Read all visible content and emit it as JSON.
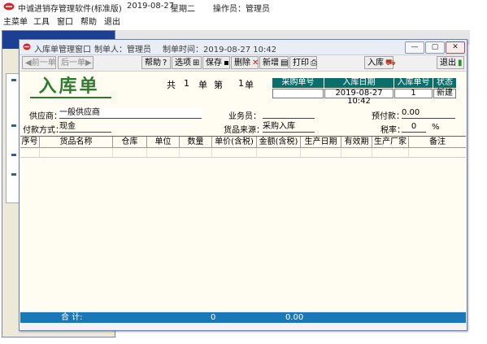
{
  "app": {
    "title": "中诚进销存管理软件(标准版)",
    "date": "2019-08-27",
    "weekday": "星期二",
    "operator_label": "操作员：管理员"
  },
  "menu": [
    "主菜单",
    "工具",
    "窗口",
    "帮助",
    "退出"
  ],
  "window": {
    "title": "入库单管理窗口",
    "maker_label": "制单人：管理员",
    "time_label": "制单时间：2019-08-27 10:42",
    "btn_min": "—",
    "btn_max": "▢",
    "btn_close": "✕"
  },
  "toolbar": {
    "prev": "◀前一单",
    "next": "后一单▶",
    "help": "帮助",
    "options": "选项",
    "save": "保存",
    "delete": "删除",
    "add": "新增",
    "print": "打印",
    "stock_in": "入库",
    "exit": "退出"
  },
  "form": {
    "title": "入库单",
    "count_total_label": "共",
    "count_total": "1",
    "count_unit1": "单",
    "count_index_label": "第",
    "count_index": "1",
    "count_unit2": "单",
    "info_headers": [
      "采购单号",
      "入库日期",
      "入库单号",
      "状态"
    ],
    "info_values": [
      "",
      "2019-08-27 10:42",
      "1",
      "新建"
    ],
    "supplier_label": "供应商：",
    "supplier": "一般供应商",
    "salesman_label": "业务员：",
    "salesman": "",
    "prepay_label": "预付款：",
    "prepay": "0.00",
    "payment_label": "付款方式：",
    "payment": "现金",
    "source_label": "货品来源：",
    "source": "采购入库",
    "tax_label": "税率：",
    "tax": "0",
    "tax_unit": "%"
  },
  "grid": {
    "columns": [
      "序号",
      "货品名称",
      "仓库",
      "单位",
      "数量",
      "单价(含税)",
      "金额(含税)",
      "生产日期",
      "有效期",
      "生产厂家",
      "备注"
    ],
    "rows": []
  },
  "totals": {
    "label": "合  计:",
    "quantity": "0",
    "amount": "0.00"
  },
  "colors": {
    "accent": "#1b78b8",
    "header": "#0b6e6a",
    "title": "#2f7a2f"
  }
}
